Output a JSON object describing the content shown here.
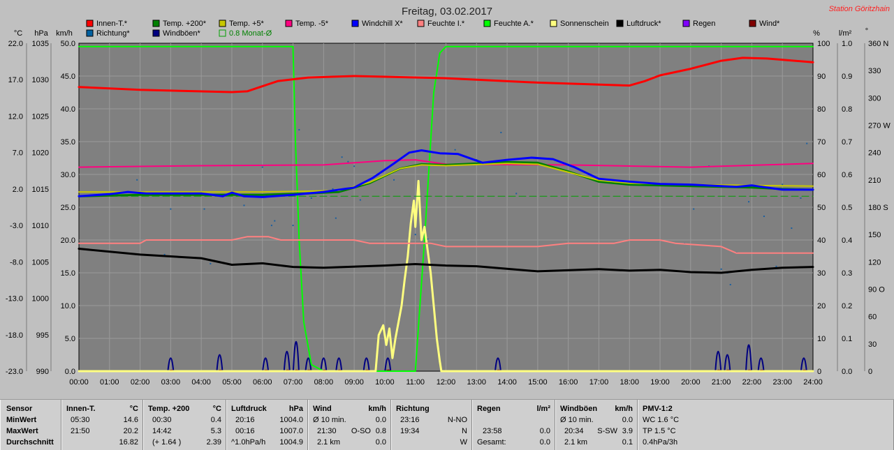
{
  "chart_data": {
    "type": "line",
    "title": "Freitag, 03.02.2017",
    "station": "Station Göritzhain",
    "x_labels": [
      "00:00",
      "01:00",
      "02:00",
      "03:00",
      "04:00",
      "05:00",
      "06:00",
      "07:00",
      "08:00",
      "09:00",
      "10:00",
      "11:00",
      "12:00",
      "13:00",
      "14:00",
      "15:00",
      "16:00",
      "17:00",
      "18:00",
      "19:00",
      "20:00",
      "21:00",
      "22:00",
      "23:00",
      "24:00"
    ],
    "x_range_h": [
      0,
      24
    ],
    "axes": {
      "celsius": {
        "unit": "°C",
        "ticks": [
          "22.0",
          "17.0",
          "12.0",
          "7.0",
          "2.0",
          "-3.0",
          "-8.0",
          "-13.0",
          "-18.0",
          "-23.0"
        ],
        "range": [
          -23,
          22
        ]
      },
      "hpa": {
        "unit": "hPa",
        "ticks": [
          "1035",
          "1030",
          "1025",
          "1020",
          "1015",
          "1010",
          "1005",
          "1000",
          "995",
          "990"
        ],
        "range": [
          990,
          1035
        ]
      },
      "kmh": {
        "unit": "km/h",
        "ticks": [
          "50.0",
          "45.0",
          "40.0",
          "35.0",
          "30.0",
          "25.0",
          "20.0",
          "15.0",
          "10.0",
          "5.0",
          "0.0"
        ],
        "range": [
          0,
          50
        ]
      },
      "percent": {
        "unit": "%",
        "ticks": [
          "100",
          "90",
          "80",
          "70",
          "60",
          "50",
          "40",
          "30",
          "20",
          "10",
          "0"
        ],
        "range": [
          0,
          100
        ]
      },
      "rain": {
        "unit": "l/m²",
        "ticks": [
          "1.0",
          "0.9",
          "0.8",
          "0.7",
          "0.6",
          "0.5",
          "0.4",
          "0.3",
          "0.2",
          "0.1",
          "0.0"
        ],
        "range": [
          0,
          1
        ]
      },
      "deg": {
        "unit": "°",
        "ticks": [
          "360 N",
          "330",
          "300",
          "270 W",
          "240",
          "210",
          "180 S",
          "150",
          "120",
          "90 O",
          "60",
          "30",
          "0"
        ],
        "range": [
          0,
          360
        ]
      }
    },
    "grid": true,
    "legend": [
      {
        "name": "Innen-T.*",
        "color": "#ff0000"
      },
      {
        "name": "Temp. +200*",
        "color": "#008000"
      },
      {
        "name": "Temp. +5*",
        "color": "#c8c800"
      },
      {
        "name": "Temp. -5*",
        "color": "#ff0080"
      },
      {
        "name": "Windchill X*",
        "color": "#0000ff"
      },
      {
        "name": "Feuchte I.*",
        "color": "#ff8080"
      },
      {
        "name": "Feuchte A.*",
        "color": "#00ff00"
      },
      {
        "name": "Sonnenschein",
        "color": "#ffff80"
      },
      {
        "name": "Luftdruck*",
        "color": "#000000"
      },
      {
        "name": "Regen",
        "color": "#8000ff"
      },
      {
        "name": "Wind*",
        "color": "#800000"
      },
      {
        "name": "Richtung*",
        "color": "#0060a0"
      },
      {
        "name": "Windböen*",
        "color": "#000080"
      },
      {
        "name": "0.8 Monat-Ø",
        "color": "#00c000"
      }
    ],
    "series": [
      {
        "key": "innen",
        "axis": "celsius",
        "color": "#ff0000",
        "width": 3,
        "points": [
          [
            0,
            16.0
          ],
          [
            2,
            15.6
          ],
          [
            5,
            15.3
          ],
          [
            5.5,
            15.4
          ],
          [
            6.5,
            16.8
          ],
          [
            7.5,
            17.3
          ],
          [
            9,
            17.5
          ],
          [
            12,
            17.2
          ],
          [
            15,
            16.6
          ],
          [
            18,
            16.2
          ],
          [
            18.5,
            16.8
          ],
          [
            19,
            17.6
          ],
          [
            20,
            18.5
          ],
          [
            21,
            19.6
          ],
          [
            21.7,
            20.0
          ],
          [
            22.5,
            19.9
          ],
          [
            24,
            19.4
          ]
        ]
      },
      {
        "key": "temp200",
        "axis": "celsius",
        "color": "#008000",
        "width": 3,
        "points": [
          [
            0,
            1.0
          ],
          [
            2,
            1.2
          ],
          [
            6,
            1.2
          ],
          [
            7.5,
            1.4
          ],
          [
            8.5,
            1.6
          ],
          [
            9.5,
            2.8
          ],
          [
            10.5,
            4.8
          ],
          [
            11.2,
            5.4
          ],
          [
            12,
            5.3
          ],
          [
            14,
            5.7
          ],
          [
            15,
            5.6
          ],
          [
            16,
            4.4
          ],
          [
            17,
            3.0
          ],
          [
            18,
            2.6
          ],
          [
            20,
            2.4
          ],
          [
            22,
            2.2
          ],
          [
            23,
            2.0
          ],
          [
            24,
            1.9
          ]
        ]
      },
      {
        "key": "temp5",
        "axis": "celsius",
        "color": "#c8c800",
        "width": 2,
        "points": [
          [
            0,
            1.6
          ],
          [
            2,
            1.6
          ],
          [
            6,
            1.6
          ],
          [
            7.5,
            1.7
          ],
          [
            8.5,
            1.8
          ],
          [
            9.5,
            2.9
          ],
          [
            10.5,
            4.8
          ],
          [
            11.2,
            5.3
          ],
          [
            12,
            5.2
          ],
          [
            14,
            5.5
          ],
          [
            15,
            5.4
          ],
          [
            16,
            4.3
          ],
          [
            17,
            3.2
          ],
          [
            18,
            2.8
          ],
          [
            20,
            2.6
          ],
          [
            22,
            2.5
          ],
          [
            24,
            2.4
          ]
        ]
      },
      {
        "key": "tempm5",
        "axis": "celsius",
        "color": "#ff0080",
        "width": 2,
        "points": [
          [
            0,
            5.0
          ],
          [
            4,
            5.2
          ],
          [
            8,
            5.3
          ],
          [
            10,
            5.9
          ],
          [
            11,
            6.0
          ],
          [
            12,
            5.4
          ],
          [
            16,
            5.3
          ],
          [
            20,
            5.0
          ],
          [
            24,
            5.5
          ]
        ]
      },
      {
        "key": "windchill",
        "axis": "celsius",
        "color": "#0000ff",
        "width": 3,
        "points": [
          [
            0,
            1.0
          ],
          [
            1,
            1.3
          ],
          [
            1.6,
            1.6
          ],
          [
            2.2,
            1.4
          ],
          [
            4,
            1.4
          ],
          [
            4.7,
            1.0
          ],
          [
            5,
            1.5
          ],
          [
            5.4,
            1.0
          ],
          [
            6,
            0.9
          ],
          [
            7,
            1.2
          ],
          [
            8,
            1.6
          ],
          [
            9,
            2.2
          ],
          [
            9.6,
            3.5
          ],
          [
            10.3,
            5.5
          ],
          [
            10.8,
            7.0
          ],
          [
            11.2,
            7.3
          ],
          [
            11.8,
            6.9
          ],
          [
            12.4,
            6.8
          ],
          [
            13.2,
            5.6
          ],
          [
            14,
            6.0
          ],
          [
            14.8,
            6.3
          ],
          [
            15.5,
            6.1
          ],
          [
            16.2,
            5.0
          ],
          [
            17,
            3.4
          ],
          [
            18,
            3.0
          ],
          [
            19,
            2.7
          ],
          [
            20,
            2.6
          ],
          [
            21,
            2.4
          ],
          [
            21.5,
            2.3
          ],
          [
            22,
            2.5
          ],
          [
            22.5,
            2.2
          ],
          [
            23,
            1.9
          ],
          [
            24,
            1.9
          ]
        ]
      },
      {
        "key": "feuchte_i",
        "axis": "percent",
        "color": "#ff8080",
        "width": 2,
        "points": [
          [
            0,
            39
          ],
          [
            2,
            39
          ],
          [
            2.2,
            40
          ],
          [
            5,
            40
          ],
          [
            5.5,
            41
          ],
          [
            6.2,
            41
          ],
          [
            6.6,
            40
          ],
          [
            9,
            40
          ],
          [
            9.5,
            39
          ],
          [
            11.5,
            39
          ],
          [
            12,
            38
          ],
          [
            14,
            38
          ],
          [
            15,
            38
          ],
          [
            16,
            39
          ],
          [
            17.5,
            39
          ],
          [
            18,
            40
          ],
          [
            19,
            40
          ],
          [
            19.5,
            39
          ],
          [
            21,
            38
          ],
          [
            21.5,
            36
          ],
          [
            22,
            36
          ],
          [
            24,
            36
          ]
        ]
      },
      {
        "key": "luftdruck",
        "axis": "hpa",
        "color": "#000000",
        "width": 3,
        "points": [
          [
            0,
            1006.8
          ],
          [
            2,
            1006.0
          ],
          [
            4,
            1005.5
          ],
          [
            5,
            1004.6
          ],
          [
            6,
            1004.8
          ],
          [
            7,
            1004.3
          ],
          [
            8,
            1004.2
          ],
          [
            10,
            1004.5
          ],
          [
            11,
            1004.7
          ],
          [
            12,
            1004.5
          ],
          [
            13,
            1004.4
          ],
          [
            15,
            1003.7
          ],
          [
            17,
            1004.0
          ],
          [
            18,
            1003.8
          ],
          [
            19,
            1003.9
          ],
          [
            20,
            1003.6
          ],
          [
            21,
            1003.5
          ],
          [
            22,
            1003.9
          ],
          [
            23,
            1004.2
          ],
          [
            24,
            1004.3
          ]
        ]
      },
      {
        "key": "feuchte_a",
        "axis": "percent",
        "color": "#00ff00",
        "width": 2,
        "points": [
          [
            0,
            99
          ],
          [
            6.1,
            99
          ],
          [
            7.0,
            99
          ],
          [
            7.08,
            70
          ],
          [
            7.14,
            55
          ],
          [
            7.2,
            40
          ],
          [
            7.35,
            15
          ],
          [
            7.6,
            2
          ],
          [
            8,
            0
          ],
          [
            11.0,
            0
          ],
          [
            11.3,
            40
          ],
          [
            11.6,
            85
          ],
          [
            11.8,
            97
          ],
          [
            12,
            99
          ],
          [
            24,
            99
          ]
        ]
      },
      {
        "key": "monat",
        "axis": "celsius",
        "color": "#00a000",
        "width": 1,
        "dash": "10,5",
        "points": [
          [
            0,
            1.0
          ],
          [
            24,
            1.0
          ]
        ]
      },
      {
        "key": "sonne",
        "axis": "percent",
        "color": "#ffff80",
        "width": 3,
        "points": [
          [
            0,
            0
          ],
          [
            9.7,
            0
          ],
          [
            9.8,
            11
          ],
          [
            9.95,
            14
          ],
          [
            10.05,
            8
          ],
          [
            10.15,
            13
          ],
          [
            10.25,
            4
          ],
          [
            10.35,
            10
          ],
          [
            10.45,
            15
          ],
          [
            10.55,
            20
          ],
          [
            10.65,
            28
          ],
          [
            10.75,
            35
          ],
          [
            10.85,
            45
          ],
          [
            10.95,
            52
          ],
          [
            11.0,
            44
          ],
          [
            11.1,
            58
          ],
          [
            11.2,
            40
          ],
          [
            11.3,
            44
          ],
          [
            11.4,
            37
          ],
          [
            11.5,
            30
          ],
          [
            11.6,
            20
          ],
          [
            11.7,
            10
          ],
          [
            11.8,
            3
          ],
          [
            11.85,
            0
          ],
          [
            24,
            0
          ]
        ]
      }
    ],
    "scatter_richtung": [
      [
        1.9,
        210
      ],
      [
        2.8,
        128
      ],
      [
        3.0,
        178
      ],
      [
        4.3,
        118
      ],
      [
        4.6,
        120
      ],
      [
        4.1,
        178
      ],
      [
        5.4,
        182
      ],
      [
        6.0,
        224
      ],
      [
        6.3,
        160
      ],
      [
        6.4,
        165
      ],
      [
        7.0,
        160
      ],
      [
        7.2,
        265
      ],
      [
        7.6,
        190
      ],
      [
        8.3,
        200
      ],
      [
        8.4,
        168
      ],
      [
        8.6,
        235
      ],
      [
        8.8,
        230
      ],
      [
        9.0,
        225
      ],
      [
        9.2,
        188
      ],
      [
        10.3,
        210
      ],
      [
        10.9,
        225
      ],
      [
        11.0,
        150
      ],
      [
        11.4,
        145
      ],
      [
        12.3,
        243
      ],
      [
        13.0,
        232
      ],
      [
        13.8,
        262
      ],
      [
        14.3,
        195
      ],
      [
        19.8,
        140
      ],
      [
        20.1,
        178
      ],
      [
        20.6,
        225
      ],
      [
        21.0,
        112
      ],
      [
        21.2,
        108
      ],
      [
        21.3,
        95
      ],
      [
        21.5,
        130
      ],
      [
        21.9,
        186
      ],
      [
        22.4,
        170
      ],
      [
        22.8,
        115
      ],
      [
        23.0,
        205
      ],
      [
        23.3,
        157
      ],
      [
        23.6,
        190
      ],
      [
        23.8,
        250
      ]
    ],
    "wind_bumps": [
      [
        3.0,
        2
      ],
      [
        4.6,
        2.5
      ],
      [
        6.1,
        2
      ],
      [
        6.8,
        3
      ],
      [
        7.1,
        4.5
      ],
      [
        7.5,
        2
      ],
      [
        8.0,
        2
      ],
      [
        8.5,
        2
      ],
      [
        9.4,
        2
      ],
      [
        10.1,
        2
      ],
      [
        13.7,
        2
      ],
      [
        20.9,
        3
      ],
      [
        21.2,
        2.5
      ],
      [
        21.9,
        4
      ],
      [
        22.3,
        2
      ],
      [
        23.7,
        2
      ]
    ]
  },
  "summary": {
    "sensor": {
      "title": "Sensor",
      "labels": [
        "MinWert",
        "MaxWert",
        "Durchschnitt"
      ]
    },
    "innen": {
      "title": "Innen-T.",
      "unit": "°C",
      "times": [
        "05:30",
        "21:50",
        ""
      ],
      "values": [
        "14.6",
        "20.2",
        "16.82"
      ]
    },
    "temp200": {
      "title": "Temp. +200",
      "unit": "°C",
      "times": [
        "00:30",
        "14:42",
        "(+ 1.64 )"
      ],
      "values": [
        "0.4",
        "5.3",
        "2.39"
      ]
    },
    "luftdruck": {
      "title": "Luftdruck",
      "unit": "hPa",
      "times": [
        "20:16",
        "00:16",
        "^1.0hPa/h"
      ],
      "values": [
        "1004.0",
        "1007.0",
        "1004.9"
      ]
    },
    "wind": {
      "title": "Wind",
      "unit": "km/h",
      "times": [
        "Ø 10 min.",
        "21:30",
        "2.1 km"
      ],
      "extra": [
        "",
        "O-SO",
        ""
      ],
      "values": [
        "0.0",
        "0.8",
        "0.0"
      ]
    },
    "richtung": {
      "title": "Richtung",
      "times": [
        "23:16",
        "19:34",
        ""
      ],
      "values": [
        "N-NO",
        "N",
        "W"
      ]
    },
    "regen": {
      "title": "Regen",
      "unit": "l/m²",
      "times": [
        "",
        "23:58",
        "Gesamt:"
      ],
      "values": [
        "",
        "0.0",
        "0.0"
      ]
    },
    "windboeen": {
      "title": "Windböen",
      "unit": "km/h",
      "times": [
        "Ø 10 min.",
        "20:34",
        "2.1 km"
      ],
      "extra": [
        "",
        "S-SW",
        ""
      ],
      "values": [
        "0.0",
        "3.9",
        "0.1"
      ]
    },
    "pmv": {
      "title": "PMV-1:2",
      "lines": [
        "WC 1.6 °C",
        "TP 1.5 °C",
        "0.4hPa/3h"
      ]
    }
  }
}
